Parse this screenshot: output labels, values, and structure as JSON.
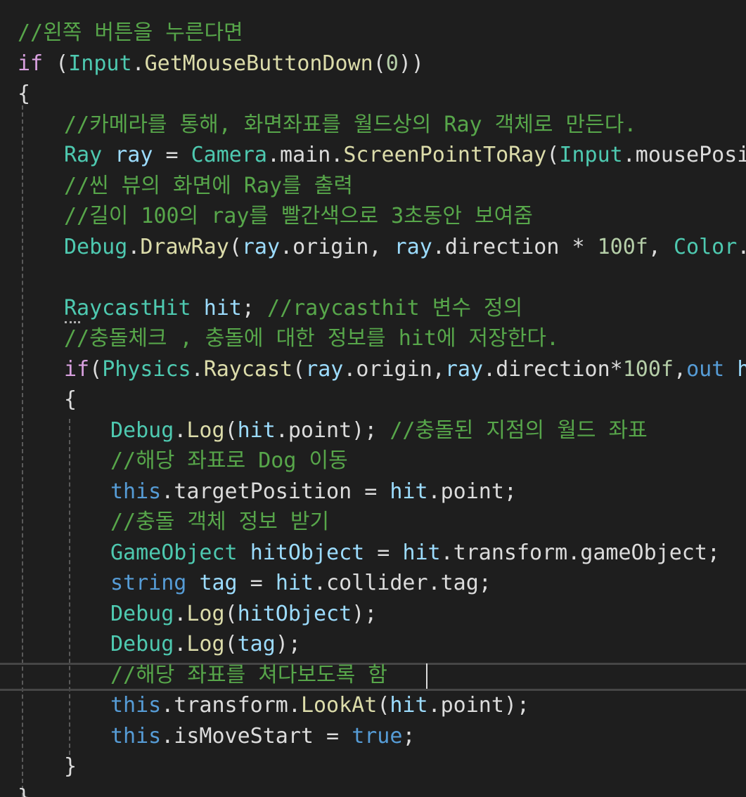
{
  "code_lines": [
    [
      {
        "t": "//왼쪽 버튼을 누른다면",
        "k": "comment"
      }
    ],
    [
      {
        "t": "if",
        "k": "control"
      },
      {
        "t": " (",
        "k": "plain"
      },
      {
        "t": "Input",
        "k": "type"
      },
      {
        "t": ".",
        "k": "plain"
      },
      {
        "t": "GetMouseButtonDown",
        "k": "method"
      },
      {
        "t": "(",
        "k": "plain"
      },
      {
        "t": "0",
        "k": "number"
      },
      {
        "t": "))",
        "k": "plain"
      }
    ],
    [
      {
        "t": "{",
        "k": "plain"
      }
    ],
    [
      {
        "t": "//카메라를 통해, 화면좌표를 월드상의 Ray 객체로 만든다.",
        "k": "comment"
      }
    ],
    [
      {
        "t": "Ray",
        "k": "type"
      },
      {
        "t": " ",
        "k": "plain"
      },
      {
        "t": "ray",
        "k": "local"
      },
      {
        "t": " = ",
        "k": "plain"
      },
      {
        "t": "Camera",
        "k": "type"
      },
      {
        "t": ".main.",
        "k": "plain"
      },
      {
        "t": "ScreenPointToRay",
        "k": "method"
      },
      {
        "t": "(",
        "k": "plain"
      },
      {
        "t": "Input",
        "k": "type"
      },
      {
        "t": ".mousePosition)",
        "k": "plain"
      }
    ],
    [
      {
        "t": "//씬 뷰의 화면에 Ray를 출력",
        "k": "comment"
      }
    ],
    [
      {
        "t": "//길이 100의 ray를 빨간색으로 3초동안 보여줌",
        "k": "comment"
      }
    ],
    [
      {
        "t": "Debug",
        "k": "type"
      },
      {
        "t": ".",
        "k": "plain"
      },
      {
        "t": "DrawRay",
        "k": "method"
      },
      {
        "t": "(",
        "k": "plain"
      },
      {
        "t": "ray",
        "k": "local"
      },
      {
        "t": ".origin, ",
        "k": "plain"
      },
      {
        "t": "ray",
        "k": "local"
      },
      {
        "t": ".direction * ",
        "k": "plain"
      },
      {
        "t": "100f",
        "k": "number"
      },
      {
        "t": ", ",
        "k": "plain"
      },
      {
        "t": "Color",
        "k": "type"
      },
      {
        "t": ".red,",
        "k": "plain"
      }
    ],
    [],
    [
      {
        "t": "RaycastHit",
        "k": "type"
      },
      {
        "t": " ",
        "k": "plain"
      },
      {
        "t": "hit",
        "k": "local"
      },
      {
        "t": "; ",
        "k": "plain"
      },
      {
        "t": "//raycasthit 변수 정의",
        "k": "comment"
      }
    ],
    [
      {
        "t": "//충돌체크 , 충돌에 대한 정보를 hit에 저장한다.",
        "k": "comment"
      }
    ],
    [
      {
        "t": "if",
        "k": "control"
      },
      {
        "t": "(",
        "k": "plain"
      },
      {
        "t": "Physics",
        "k": "type"
      },
      {
        "t": ".",
        "k": "plain"
      },
      {
        "t": "Raycast",
        "k": "method"
      },
      {
        "t": "(",
        "k": "plain"
      },
      {
        "t": "ray",
        "k": "local"
      },
      {
        "t": ".origin,",
        "k": "plain"
      },
      {
        "t": "ray",
        "k": "local"
      },
      {
        "t": ".direction*",
        "k": "plain"
      },
      {
        "t": "100f",
        "k": "number"
      },
      {
        "t": ",",
        "k": "plain"
      },
      {
        "t": "out",
        "k": "keyword"
      },
      {
        "t": " ",
        "k": "plain"
      },
      {
        "t": "hit",
        "k": "local"
      },
      {
        "t": "))",
        "k": "plain"
      }
    ],
    [
      {
        "t": "{",
        "k": "plain"
      }
    ],
    [
      {
        "t": "Debug",
        "k": "type"
      },
      {
        "t": ".",
        "k": "plain"
      },
      {
        "t": "Log",
        "k": "method"
      },
      {
        "t": "(",
        "k": "plain"
      },
      {
        "t": "hit",
        "k": "local"
      },
      {
        "t": ".point); ",
        "k": "plain"
      },
      {
        "t": "//충돌된 지점의 월드 좌표",
        "k": "comment"
      }
    ],
    [
      {
        "t": "//해당 좌표로 Dog 이동",
        "k": "comment"
      }
    ],
    [
      {
        "t": "this",
        "k": "keyword"
      },
      {
        "t": ".targetPosition = ",
        "k": "plain"
      },
      {
        "t": "hit",
        "k": "local"
      },
      {
        "t": ".point;",
        "k": "plain"
      }
    ],
    [
      {
        "t": "//충돌 객체 정보 받기",
        "k": "comment"
      }
    ],
    [
      {
        "t": "GameObject",
        "k": "type"
      },
      {
        "t": " ",
        "k": "plain"
      },
      {
        "t": "hitObject",
        "k": "local"
      },
      {
        "t": " = ",
        "k": "plain"
      },
      {
        "t": "hit",
        "k": "local"
      },
      {
        "t": ".transform.gameObject;",
        "k": "plain"
      }
    ],
    [
      {
        "t": "string",
        "k": "keyword"
      },
      {
        "t": " ",
        "k": "plain"
      },
      {
        "t": "tag",
        "k": "local"
      },
      {
        "t": " = ",
        "k": "plain"
      },
      {
        "t": "hit",
        "k": "local"
      },
      {
        "t": ".collider.tag;",
        "k": "plain"
      }
    ],
    [
      {
        "t": "Debug",
        "k": "type"
      },
      {
        "t": ".",
        "k": "plain"
      },
      {
        "t": "Log",
        "k": "method"
      },
      {
        "t": "(",
        "k": "plain"
      },
      {
        "t": "hitObject",
        "k": "local"
      },
      {
        "t": ");",
        "k": "plain"
      }
    ],
    [
      {
        "t": "Debug",
        "k": "type"
      },
      {
        "t": ".",
        "k": "plain"
      },
      {
        "t": "Log",
        "k": "method"
      },
      {
        "t": "(",
        "k": "plain"
      },
      {
        "t": "tag",
        "k": "local"
      },
      {
        "t": ");",
        "k": "plain"
      }
    ],
    [
      {
        "t": "//해당 좌표를 쳐다보도록 함",
        "k": "comment"
      }
    ],
    [
      {
        "t": "this",
        "k": "keyword"
      },
      {
        "t": ".transform.",
        "k": "plain"
      },
      {
        "t": "LookAt",
        "k": "method"
      },
      {
        "t": "(",
        "k": "plain"
      },
      {
        "t": "hit",
        "k": "local"
      },
      {
        "t": ".point);",
        "k": "plain"
      }
    ],
    [
      {
        "t": "this",
        "k": "keyword"
      },
      {
        "t": ".isMoveStart = ",
        "k": "plain"
      },
      {
        "t": "true",
        "k": "keyword"
      },
      {
        "t": ";",
        "k": "plain"
      }
    ],
    [
      {
        "t": "}",
        "k": "plain"
      }
    ],
    [
      {
        "t": "}",
        "k": "plain"
      }
    ]
  ],
  "current_line_index": 21,
  "colors": {
    "background": "#1e1e1e",
    "comment": "#57a64a",
    "keyword": "#569cd6",
    "control": "#d8a0df",
    "type": "#4ec9b0",
    "method": "#dcdcaa",
    "local": "#9cdcfe",
    "number": "#b5cea8",
    "plain": "#dcdcdc"
  }
}
